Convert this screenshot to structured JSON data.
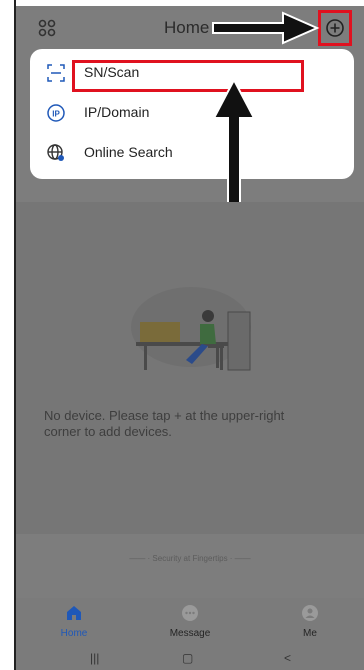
{
  "header": {
    "title": "Home",
    "left_icon": "grid-icon",
    "right_icon": "add-circle-icon"
  },
  "add_menu": {
    "items": [
      {
        "icon": "scan-icon",
        "label": "SN/Scan"
      },
      {
        "icon": "ip-icon",
        "label": "IP/Domain"
      },
      {
        "icon": "globe-search-icon",
        "label": "Online Search"
      }
    ]
  },
  "empty_state": {
    "message": "No device. Please tap + at the upper-right corner to add devices."
  },
  "footer": {
    "security_text": "Security at Fingertips"
  },
  "tabbar": {
    "tabs": [
      {
        "label": "Home",
        "icon": "home-icon",
        "active": true
      },
      {
        "label": "Message",
        "icon": "message-icon",
        "active": false
      },
      {
        "label": "Me",
        "icon": "person-icon",
        "active": false
      }
    ]
  },
  "system_nav": {
    "recents": "|||",
    "home": "▢",
    "back": "<"
  },
  "colors": {
    "annotation_red": "#e0111f",
    "accent_blue": "#1f58b8",
    "overlay_gray": "#7d7d7d"
  }
}
